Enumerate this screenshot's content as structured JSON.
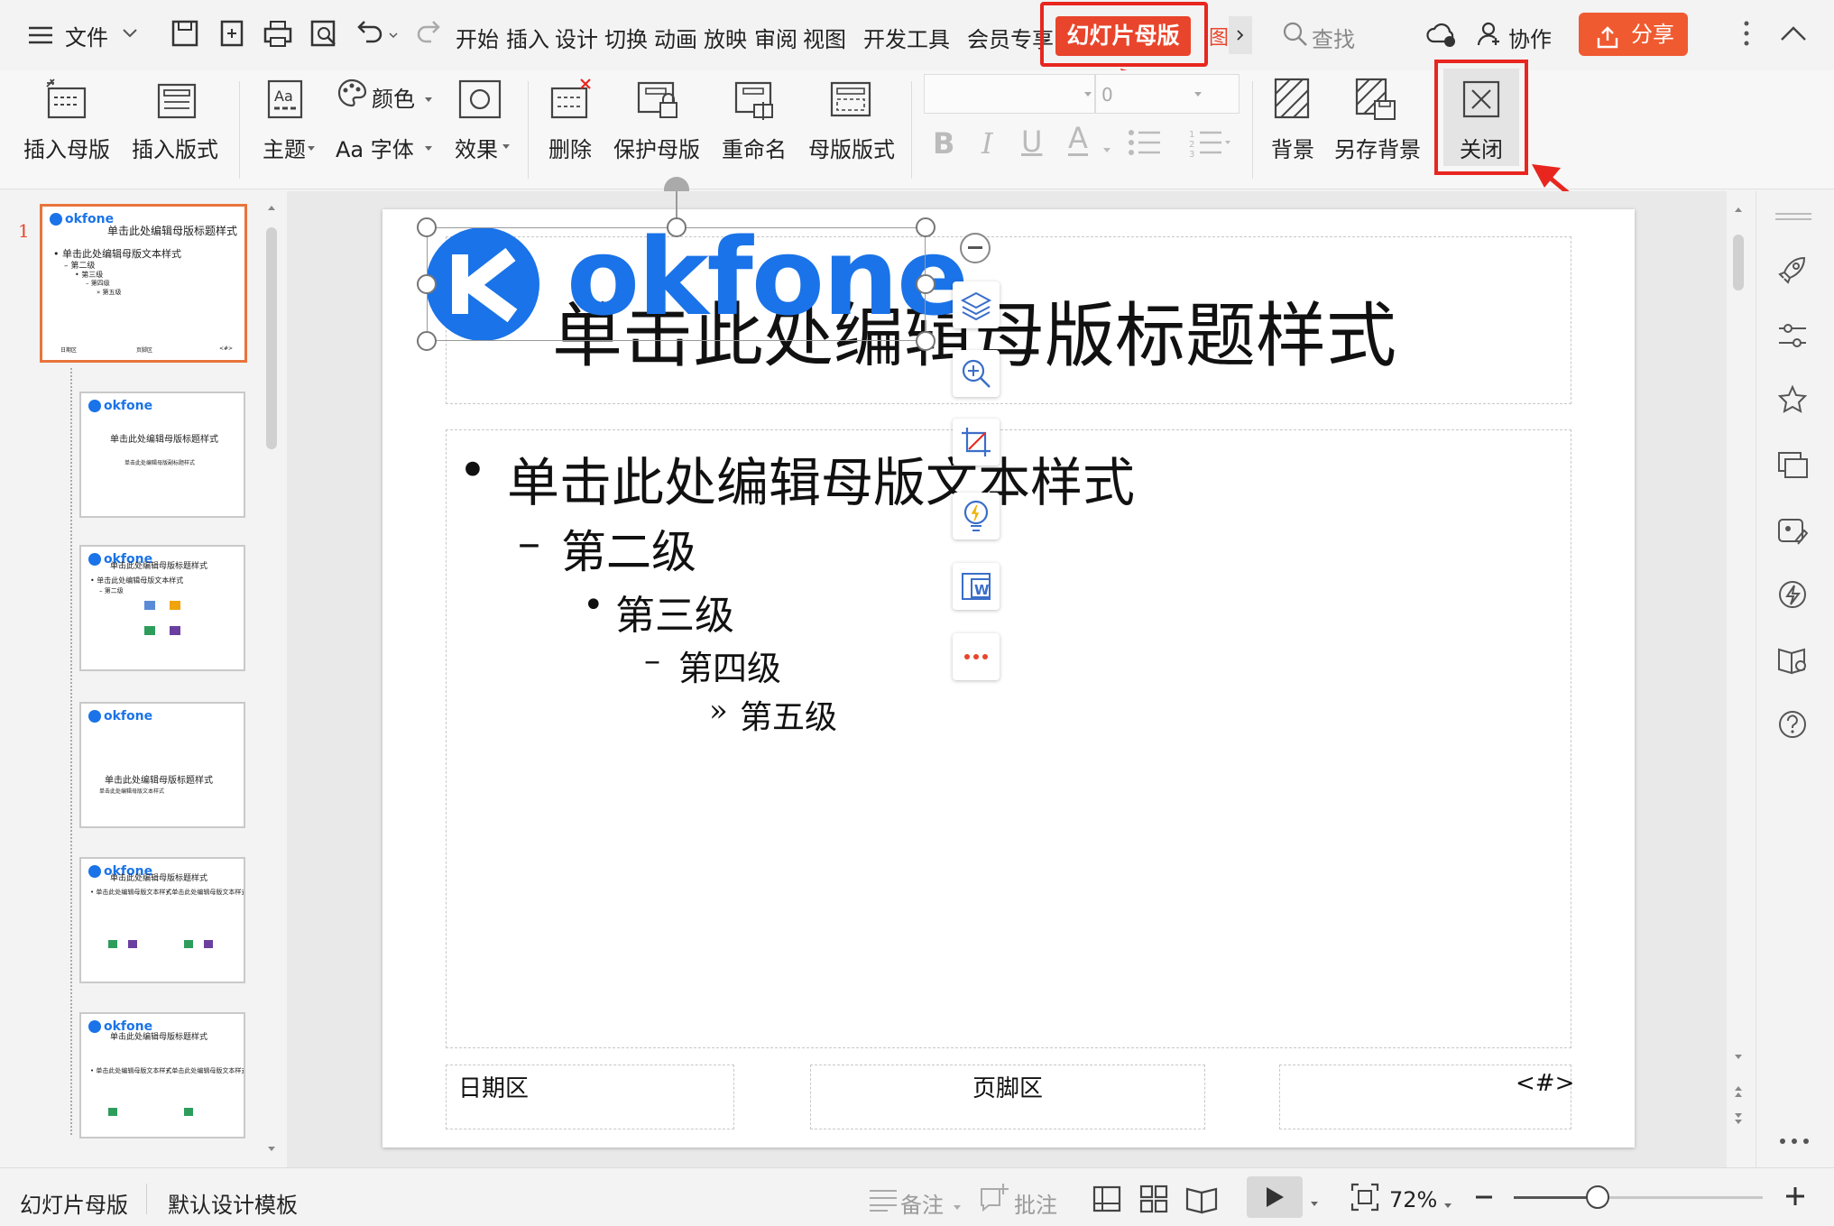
{
  "menubar": {
    "file_label": "文件",
    "tabs": [
      "开始",
      "插入",
      "设计",
      "切换",
      "动画",
      "放映",
      "审阅",
      "视图",
      "开发工具",
      "会员专享"
    ],
    "active_tab": "幻灯片母版",
    "overflow_tab": "图",
    "search_label": "查找",
    "collab_label": "协作",
    "share_label": "分享"
  },
  "ribbon": {
    "insert_master": "插入母版",
    "insert_layout": "插入版式",
    "theme": "主题",
    "color": "颜色",
    "font": "Aa 字体",
    "effect": "效果",
    "delete": "删除",
    "protect_master": "保护母版",
    "rename": "重命名",
    "master_layout": "母版版式",
    "font_size_value": "0",
    "background": "背景",
    "save_background": "另存背景",
    "close": "关闭"
  },
  "thumbs": {
    "slide_number": "1",
    "logo_text": "okfone",
    "t1_title": "单击此处编辑母版标题样式",
    "t1_l1": "• 单击此处编辑母版文本样式",
    "t1_l2": "– 第二级",
    "t1_l3": "• 第三级",
    "t1_l4": "– 第四级",
    "t1_l5": "» 第五级",
    "t1_f1": "日期区",
    "t1_f2": "页脚区",
    "t1_f3": "<#>",
    "t2_title": "单击此处编辑母版标题样式",
    "t2_sub": "单击此处编辑母版副标题样式",
    "t3_title": "单击此处编辑母版标题样式",
    "t3_l1": "• 单击此处编辑母版文本样式",
    "t3_l2": "– 第二级",
    "t4_title": "单击此处编辑母版标题样式",
    "t4_sub": "单击此处编辑母版文本样式",
    "t5_title": "单击此处编辑母版标题样式",
    "t5_l1": "• 单击此处编辑母版文本样式",
    "t6_title": "单击此处编辑母版标题样式",
    "t6_l1": "• 单击此处编辑母版文本样式"
  },
  "slide": {
    "logo_text": "okfone",
    "title": "单击此处编辑母版标题样式",
    "level1": "单击此处编辑母版文本样式",
    "level2": "第二级",
    "level3": "第三级",
    "level4": "第四级",
    "level5": "第五级",
    "bullet1": "•",
    "bullet2": "–",
    "bullet3": "•",
    "bullet4": "–",
    "bullet5": "»",
    "footer_date": "日期区",
    "footer_center": "页脚区",
    "footer_num": "<#>"
  },
  "statusbar": {
    "view_name": "幻灯片母版",
    "template_name": "默认设计模板",
    "notes": "备注",
    "comments": "批注",
    "zoom": "72%"
  },
  "colors": {
    "accent": "#e8452c",
    "highlight_box": "#e8261f",
    "logo_blue": "#1a73e8",
    "share": "#f05a30"
  }
}
